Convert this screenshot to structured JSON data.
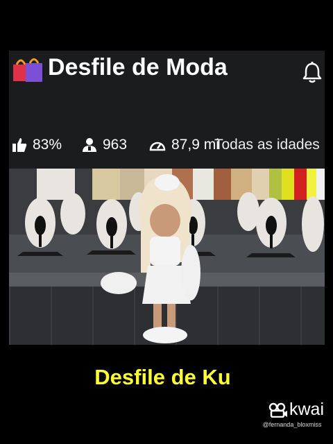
{
  "experience": {
    "title": "Desfile de Moda",
    "likes": "83%",
    "players": "963",
    "visits": "87,9 mi",
    "age_rating": "Todas as idades"
  },
  "overlay": {
    "caption": "Desfile de Ku",
    "brand": "kwai",
    "handle": "@fernanda_bloxmiss"
  },
  "colors": {
    "caption": "#ffff33",
    "card_bg": "#1b1c1e",
    "background": "#000000"
  },
  "icons": [
    "shopping-bags-icon",
    "bell-icon",
    "thumbs-up-icon",
    "players-icon",
    "visits-gauge-icon",
    "kwai-logo-icon"
  ]
}
